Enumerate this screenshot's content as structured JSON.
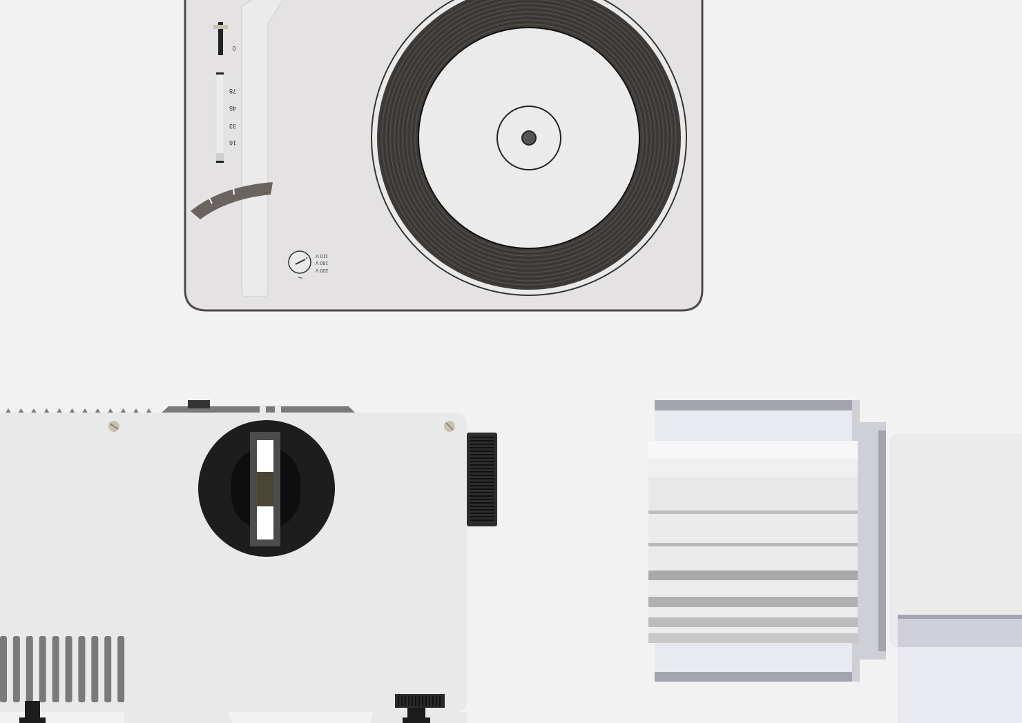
{
  "turntable": {
    "speed_labels": [
      "78",
      "45",
      "33",
      "16"
    ],
    "zero_label": "0",
    "voltage_labels": [
      "110 V",
      "160 V",
      "220 V"
    ],
    "tilde_label": "~"
  },
  "colors": {
    "background": "#f2f2f2",
    "turntable_body": "#e4e2e2",
    "turntable_outline": "#4e4a48",
    "record": "#3f3c39",
    "label": "#ebebeb",
    "projector_body": "#e9e9e9",
    "projector_lens": "#1e1d1d",
    "gray_rib": "#7a7a7a",
    "slide_frame": "#a4a4b0",
    "slide_panel": "#e9e9f2"
  },
  "icons": {
    "tonearm": "tonearm-icon",
    "speed_slider": "speed-slider-icon",
    "voltage_knob": "voltage-knob-icon",
    "focus_knob": "focus-knob-icon",
    "lens": "lens-icon",
    "screw": "screw-icon"
  }
}
